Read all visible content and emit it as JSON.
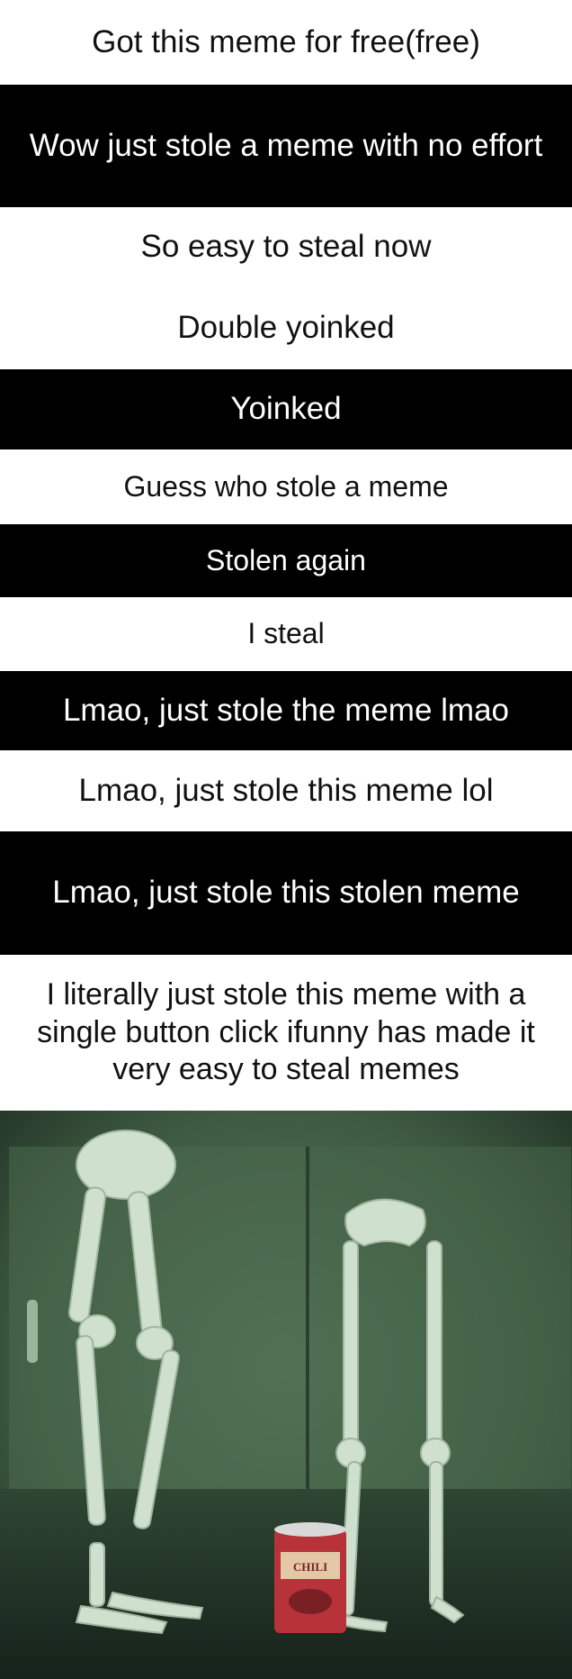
{
  "captions": [
    {
      "text": "Got this meme for free(free)",
      "style": "white"
    },
    {
      "text": "Wow just stole a meme with no effort",
      "style": "black"
    },
    {
      "text": "So easy to steal now",
      "style": "white"
    },
    {
      "text": "Double yoinked",
      "style": "white"
    },
    {
      "text": "Yoinked",
      "style": "black"
    },
    {
      "text": "Guess who stole a meme",
      "style": "white"
    },
    {
      "text": "Stolen again",
      "style": "black"
    },
    {
      "text": "I steal",
      "style": "white"
    },
    {
      "text": "Lmao, just stole the meme lmao",
      "style": "black"
    },
    {
      "text": "Lmao, just stole this meme lol",
      "style": "white"
    },
    {
      "text": "Lmao, just stole this stolen meme",
      "style": "black"
    },
    {
      "text": "I literally just stole this meme with a single button click ifunny has made it very easy to steal memes",
      "style": "white"
    }
  ],
  "image": {
    "subject": "two-skeleton-legs-with-chili-can",
    "can_label": "CHILI"
  },
  "colors": {
    "black_strip": "#000000",
    "white_strip": "#ffffff",
    "photo_green": "#3f5a43",
    "bone": "#cfe0cf",
    "can_red": "#b8323a"
  }
}
